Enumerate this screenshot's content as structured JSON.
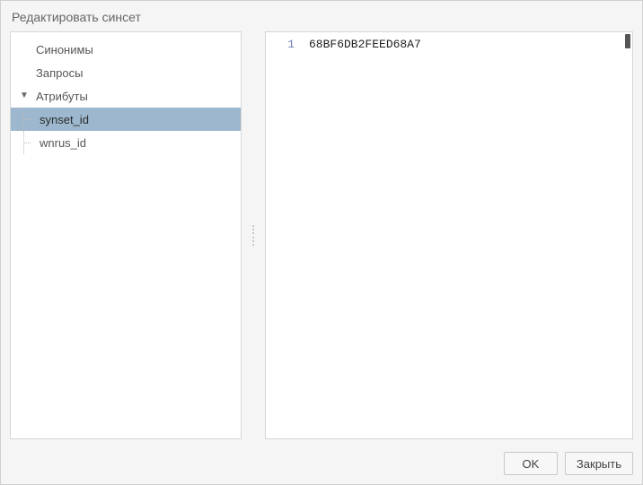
{
  "dialog": {
    "title": "Редактировать синсет"
  },
  "tree": {
    "items": [
      {
        "label": "Синонимы",
        "child": false,
        "expander": false,
        "selected": false
      },
      {
        "label": "Запросы",
        "child": false,
        "expander": false,
        "selected": false
      },
      {
        "label": "Атрибуты",
        "child": false,
        "expander": true,
        "selected": false
      },
      {
        "label": "synset_id",
        "child": true,
        "expander": false,
        "selected": true
      },
      {
        "label": "wnrus_id",
        "child": true,
        "expander": false,
        "selected": false
      }
    ]
  },
  "editor": {
    "line_number": "1",
    "content": "68BF6DB2FEED68A7"
  },
  "footer": {
    "ok_label": "OK",
    "close_label": "Закрыть"
  }
}
